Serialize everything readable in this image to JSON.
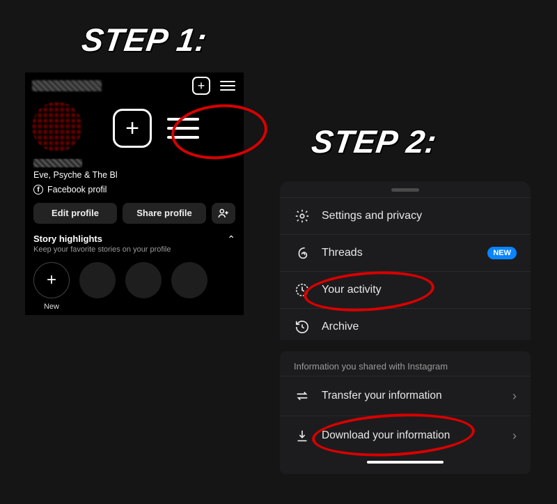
{
  "annotations": {
    "step1_label": "STEP 1:",
    "step2_label": "STEP 2:"
  },
  "profile": {
    "bio_line": "Eve, Psyche & The Bl",
    "facebook_link": "Facebook profil",
    "edit_button": "Edit profile",
    "share_button": "Share profile",
    "highlights_title": "Story highlights",
    "highlights_sub": "Keep your favorite stories on your profile",
    "new_highlight": "New"
  },
  "menu": {
    "settings": "Settings and privacy",
    "threads": "Threads",
    "threads_badge": "NEW",
    "activity": "Your activity",
    "archive": "Archive"
  },
  "download_section": {
    "caption": "Information you shared with Instagram",
    "transfer": "Transfer your information",
    "download": "Download your information"
  }
}
